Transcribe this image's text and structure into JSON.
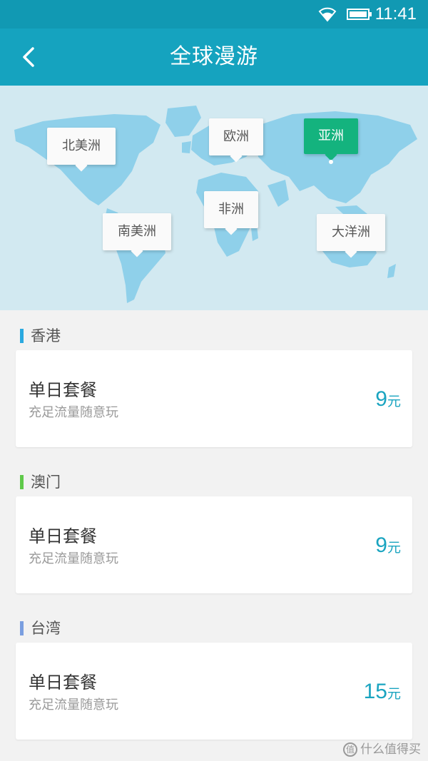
{
  "status_bar": {
    "time": "11:41",
    "wifi_icon": "wifi-icon",
    "battery_icon": "battery-icon"
  },
  "app_bar": {
    "title": "全球漫游",
    "back_icon": "chevron-left-icon"
  },
  "map": {
    "continents": [
      {
        "label": "北美洲",
        "selected": false
      },
      {
        "label": "欧洲",
        "selected": false
      },
      {
        "label": "亚洲",
        "selected": true
      },
      {
        "label": "非洲",
        "selected": false
      },
      {
        "label": "南美洲",
        "selected": false
      },
      {
        "label": "大洋洲",
        "selected": false
      }
    ]
  },
  "regions": [
    {
      "name": "香港",
      "accent": "#2aa9e0",
      "plan": {
        "name": "单日套餐",
        "desc": "充足流量随意玩",
        "price": "9",
        "unit": "元"
      }
    },
    {
      "name": "澳门",
      "accent": "#5fc94a",
      "plan": {
        "name": "单日套餐",
        "desc": "充足流量随意玩",
        "price": "9",
        "unit": "元"
      }
    },
    {
      "name": "台湾",
      "accent": "#7a9ee0",
      "plan": {
        "name": "单日套餐",
        "desc": "充足流量随意玩",
        "price": "15",
        "unit": "元"
      }
    }
  ],
  "watermark": {
    "text": "什么值得买",
    "logo_char": "值"
  },
  "colors": {
    "status_bar": "#1199b3",
    "app_bar": "#15a3bf",
    "map_bg": "#d2e9f1",
    "land": "#8fd0ea",
    "selected_tag": "#14b37e",
    "price": "#1aa4c0"
  }
}
